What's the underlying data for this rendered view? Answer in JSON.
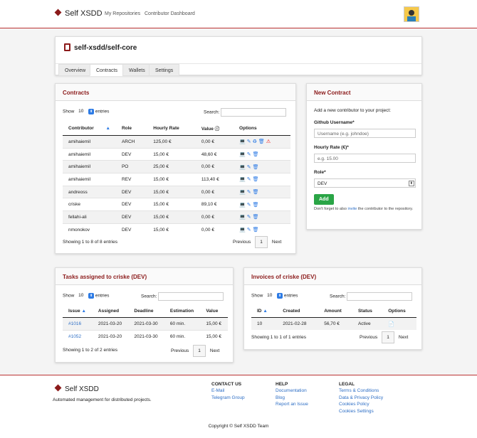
{
  "nav": {
    "brand": "Self XSDD",
    "links": [
      "My Repositories",
      "Contributor Dashboard"
    ]
  },
  "repo": {
    "title": "self-xsdd/self-core",
    "tabs": [
      "Overview",
      "Contracts",
      "Wallets",
      "Settings"
    ],
    "active_tab": "Contracts"
  },
  "contracts": {
    "title": "Contracts",
    "show": "Show",
    "entries_value": "10",
    "entries": "entries",
    "search": "Search:",
    "columns": [
      "Contributor",
      "Role",
      "Hourly Rate",
      "Value",
      "Options"
    ],
    "rows": [
      [
        "amihaiemil",
        "ARCH",
        "125,00 €",
        "0,00 €"
      ],
      [
        "amihaiemil",
        "DEV",
        "15,00 €",
        "48,60 €"
      ],
      [
        "amihaiemil",
        "PO",
        "25,00 €",
        "0,00 €"
      ],
      [
        "amihaiemil",
        "REV",
        "15,00 €",
        "113,40 €"
      ],
      [
        "andreoss",
        "DEV",
        "15,00 €",
        "0,00 €"
      ],
      [
        "criske",
        "DEV",
        "15,00 €",
        "89,10 €"
      ],
      [
        "fellahi-ali",
        "DEV",
        "15,00 €",
        "0,00 €"
      ],
      [
        "nmonokov",
        "DEV",
        "15,00 €",
        "0,00 €"
      ]
    ],
    "info": "Showing 1 to 8 of 8 entries",
    "prev": "Previous",
    "page": "1",
    "next": "Next"
  },
  "new_contract": {
    "title": "New Contract",
    "intro": "Add a new contributor to your project:",
    "github_label": "Github Username*",
    "github_placeholder": "Username (e.g. johndoe)",
    "rate_label": "Hourly Rate (€)*",
    "rate_placeholder": "e.g. 15.00",
    "role_label": "Role*",
    "role_value": "DEV",
    "add": "Add",
    "note_a": "Don't forget to also ",
    "note_link": "invite",
    "note_b": " the contributor to the repository."
  },
  "tasks": {
    "title": "Tasks assigned to criske (DEV)",
    "show": "Show",
    "entries_value": "10",
    "entries": "entries",
    "search": "Search:",
    "columns": [
      "Issue",
      "Assigned",
      "Deadline",
      "Estimation",
      "Value"
    ],
    "rows": [
      [
        "#1016",
        "2021-03-20",
        "2021-03-30",
        "60 min.",
        "15,00 €"
      ],
      [
        "#1052",
        "2021-03-20",
        "2021-03-30",
        "60 min.",
        "15,00 €"
      ]
    ],
    "info": "Showing 1 to 2 of 2 entries",
    "prev": "Previous",
    "page": "1",
    "next": "Next"
  },
  "invoices": {
    "title": "Invoices of criske (DEV)",
    "show": "Show",
    "entries_value": "10",
    "entries": "entries",
    "search": "Search:",
    "columns": [
      "ID",
      "Created",
      "Amount",
      "Status",
      "Options"
    ],
    "rows": [
      [
        "10",
        "2021-02-28",
        "56,70 €",
        "Active"
      ]
    ],
    "info": "Showing 1 to 1 of 1 entries",
    "prev": "Previous",
    "page": "1",
    "next": "Next"
  },
  "footer": {
    "brand": "Self XSDD",
    "tagline": "Automated management for distributed projects.",
    "contact_h": "CONTACT US",
    "contact": [
      "E-Mail",
      "Telegram Group"
    ],
    "help_h": "HELP",
    "help": [
      "Documentation",
      "Blog",
      "Report an Issue"
    ],
    "legal_h": "LEGAL",
    "legal": [
      "Terms & Conditions",
      "Data & Privacy Policy",
      "Cookies Policy",
      "Cookies Settings"
    ],
    "copyright": "Copyright © Self XSDD Team"
  },
  "colors": {
    "brand": "#8b1a1a",
    "link": "#2d6ec5",
    "add": "#2aa546"
  }
}
